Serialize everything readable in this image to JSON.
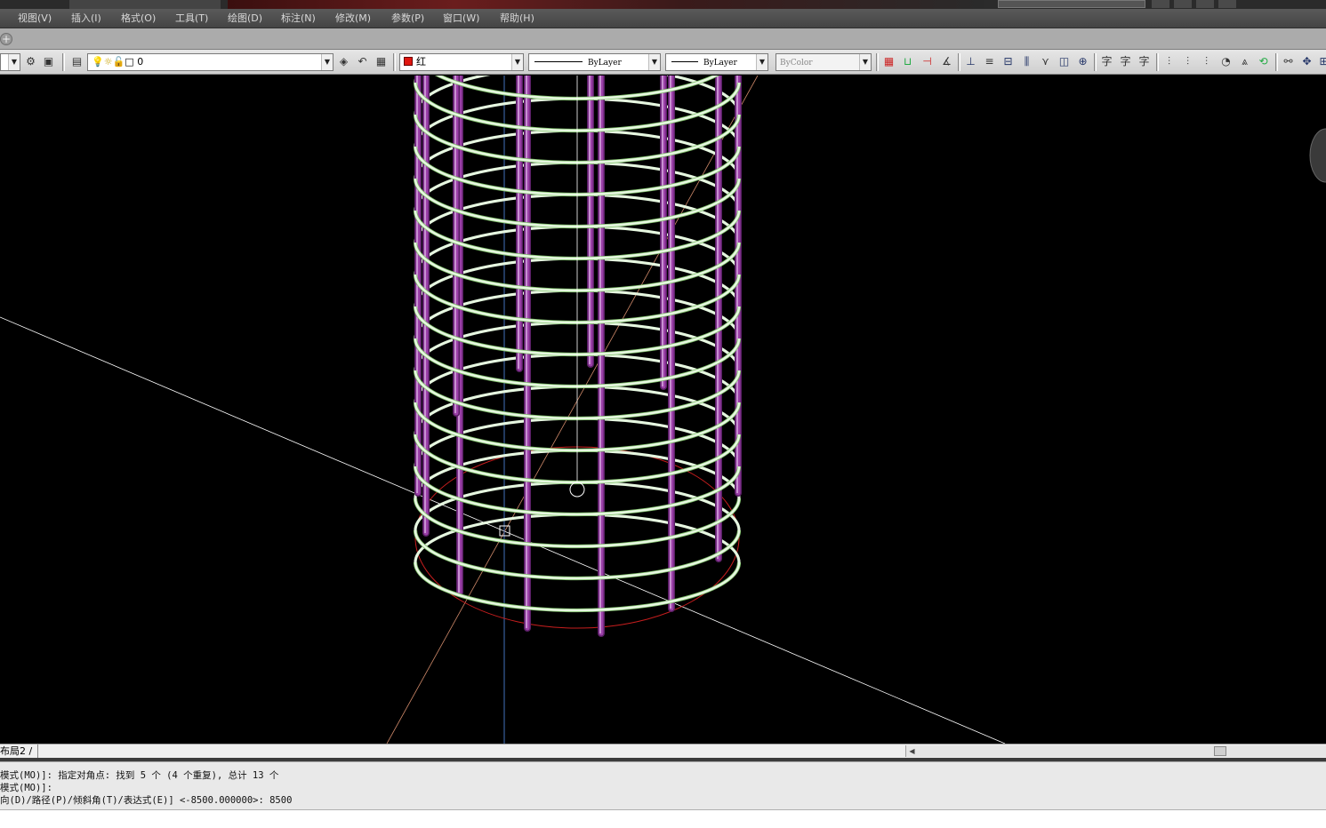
{
  "menu": {
    "items": [
      "视图(V)",
      "插入(I)",
      "格式(O)",
      "工具(T)",
      "绘图(D)",
      "标注(N)",
      "修改(M)",
      "参数(P)",
      "窗口(W)",
      "帮助(H)"
    ]
  },
  "toolbar": {
    "layer_value": "0",
    "color_value": "红",
    "color_swatch": "#e0160f",
    "linetype_value": "ByLayer",
    "lineweight_value": "ByLayer",
    "plotstyle_value": "ByColor"
  },
  "layout": {
    "tab_label": "布局2 /"
  },
  "command": {
    "line1": "模式(MO)]: 指定对角点: 找到 5 个 (4 个重复), 总计 13 个",
    "line2": "模式(MO)]:",
    "line3": "向(D)/路径(P)/倾斜角(T)/表达式(E)] <-8500.000000>: 8500"
  },
  "viewport": {
    "background": "#000000",
    "stirrup_color": "#e6f7e0",
    "rebar_color": "#9b3fa8",
    "base_circle_color": "#c81e1e",
    "axis_color": "#ffffff"
  }
}
